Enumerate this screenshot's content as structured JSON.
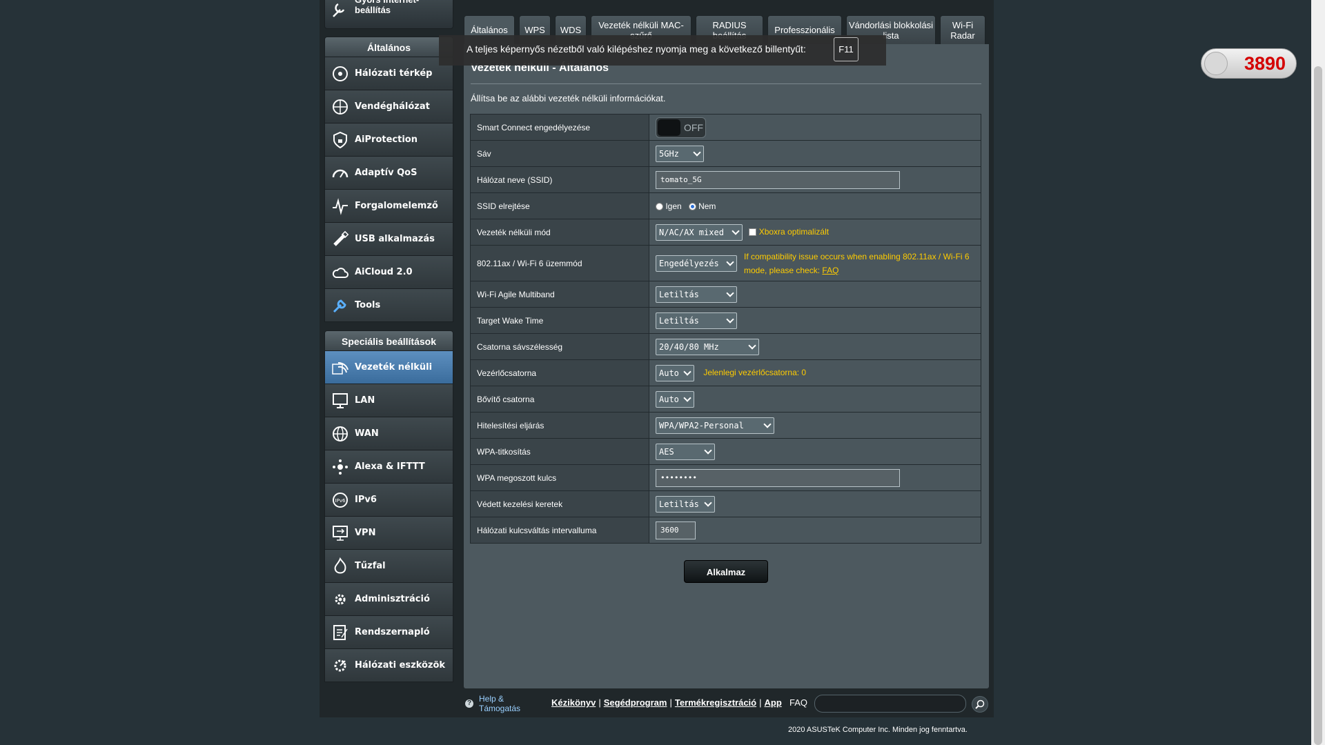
{
  "qis": {
    "label": "Gyors internet-beállítás"
  },
  "menu_general": {
    "header": "Általános",
    "items": [
      {
        "label": "Hálózati térkép",
        "icon": "network-map-icon"
      },
      {
        "label": "Vendéghálózat",
        "icon": "guest-network-icon"
      },
      {
        "label": "AiProtection",
        "icon": "shield-lock-icon"
      },
      {
        "label": "Adaptív QoS",
        "icon": "speedometer-icon"
      },
      {
        "label": "Forgalomelemző",
        "icon": "traffic-analyzer-icon"
      },
      {
        "label": "USB alkalmazás",
        "icon": "usb-icon"
      },
      {
        "label": "AiCloud 2.0",
        "icon": "cloud-icon"
      },
      {
        "label": "Tools",
        "icon": "wrench-icon"
      }
    ]
  },
  "menu_advanced": {
    "header": "Speciális beállítások",
    "items": [
      {
        "label": "Vezeték nélküli",
        "icon": "wifi-icon"
      },
      {
        "label": "LAN",
        "icon": "lan-monitor-icon"
      },
      {
        "label": "WAN",
        "icon": "globe-icon"
      },
      {
        "label": "Alexa & IFTTT",
        "icon": "alexa-icon"
      },
      {
        "label": "IPv6",
        "icon": "ipv6-icon"
      },
      {
        "label": "VPN",
        "icon": "vpn-icon"
      },
      {
        "label": "Tűzfal",
        "icon": "firewall-icon"
      },
      {
        "label": "Adminisztráció",
        "icon": "admin-gear-icon"
      },
      {
        "label": "Rendszernapló",
        "icon": "system-log-icon"
      },
      {
        "label": "Hálózati eszközök",
        "icon": "network-tools-icon"
      }
    ]
  },
  "tabs": [
    "Általános",
    "WPS",
    "WDS",
    "Vezeték nélküli MAC-szűrő",
    "RADIUS beállítás",
    "Professzionális",
    "Vándorlási blokkolási lista",
    "Wi-Fi Radar"
  ],
  "fullscreen_notice": {
    "message": "A teljes képernyős nézetből való kilépéshez nyomja meg a következő billentyűt:",
    "key": "F11"
  },
  "page": {
    "title": "Vezeték nélküli - Általános",
    "description": "Állítsa be az alábbi vezeték nélküli információkat."
  },
  "form": {
    "smart_connect": {
      "label": "Smart Connect engedélyezése",
      "state": "OFF"
    },
    "band": {
      "label": "Sáv",
      "value": "5GHz"
    },
    "ssid": {
      "label": "Hálózat neve (SSID)",
      "value": "tomato_5G"
    },
    "hide_ssid": {
      "label": "SSID elrejtése",
      "opt_yes": "Igen",
      "opt_no": "Nem",
      "selected": "Nem"
    },
    "wireless_mode": {
      "label": "Vezeték nélküli mód",
      "value": "N/AC/AX mixed",
      "xbox_label": "Xboxra optimalizált"
    },
    "ax_mode": {
      "label": "802.11ax / Wi-Fi 6 üzemmód",
      "value": "Engedélyezés",
      "hint": "If compatibility issue occurs when enabling 802.11ax / Wi-Fi 6 mode, please check:",
      "hint_link": "FAQ"
    },
    "agile_multiband": {
      "label": "Wi-Fi Agile Multiband",
      "value": "Letiltás"
    },
    "twt": {
      "label": "Target Wake Time",
      "value": "Letiltás"
    },
    "bandwidth": {
      "label": "Csatorna sávszélesség",
      "value": "20/40/80 MHz"
    },
    "control_channel": {
      "label": "Vezérlőcsatorna",
      "value": "Auto",
      "hint": "Jelenlegi vezérlőcsatorna: 0"
    },
    "extension_channel": {
      "label": "Bővítő csatorna",
      "value": "Auto"
    },
    "auth_method": {
      "label": "Hitelesítési eljárás",
      "value": "WPA/WPA2-Personal"
    },
    "wpa_encryption": {
      "label": "WPA-titkosítás",
      "value": "AES"
    },
    "wpa_key": {
      "label": "WPA megoszott kulcs",
      "value": "••••••••"
    },
    "pmf": {
      "label": "Védett kezelési keretek",
      "value": "Letiltás"
    },
    "rekey_interval": {
      "label": "Hálózati kulcsváltás intervalluma",
      "value": "3600"
    }
  },
  "apply_label": "Alkalmaz",
  "footer": {
    "help": "Help & Támogatás",
    "links": [
      "Kézikönyv",
      "Segédprogram",
      "Termékregisztráció",
      "App"
    ],
    "faq": "FAQ",
    "copyright": "2020 ASUSTeK Computer Inc. Minden jog fenntartva."
  },
  "badge": {
    "value": "3890"
  }
}
